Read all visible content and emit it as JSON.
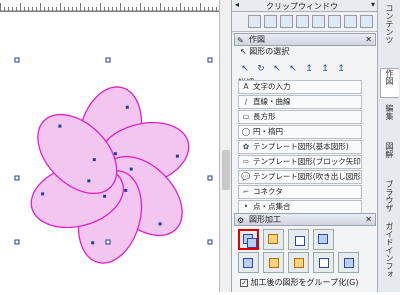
{
  "clip_window": {
    "title": "クリップウィンドウ"
  },
  "section_sakuzu": {
    "title": "作図",
    "subtitle": "図形の選択",
    "detail_label": "詳細"
  },
  "tool_list": [
    "文字の入力",
    "直線・曲線",
    "長方形",
    "円・楕円",
    "テンプレート図形(基本図形)",
    "テンプレート図形(ブロック矢印)",
    "テンプレート図形(吹き出し図形)",
    "コネクタ",
    "点・点集合"
  ],
  "section_kakou": {
    "title": "図形加工"
  },
  "group_checkbox": {
    "label": "加工後の図形をグループ化(G)",
    "checked": true
  },
  "right_tabs": [
    "コンテンツ",
    "作図",
    "編集",
    "図解",
    "ブラウザ",
    "ガイドインフォ"
  ],
  "active_tab": "作図",
  "colors": {
    "petal_fill": "#f2c6ee",
    "petal_stroke": "#e020c8",
    "handle": "#1b3fa0",
    "highlight": "#e00000"
  },
  "icons": {
    "close": "close-icon",
    "pin": "pin-icon"
  }
}
